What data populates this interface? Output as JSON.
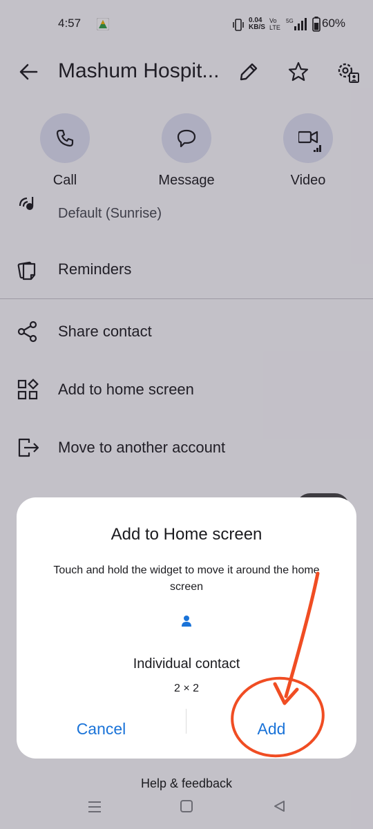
{
  "status_bar": {
    "time": "4:57",
    "right_text": "0.04 KB/S  60%",
    "battery": "60%"
  },
  "app_bar": {
    "title": "Mashum Hospit..."
  },
  "actions": [
    {
      "label": "Call"
    },
    {
      "label": "Message"
    },
    {
      "label": "Video"
    }
  ],
  "ringtone": {
    "value": "Default (Sunrise)"
  },
  "menu": {
    "reminders": "Reminders",
    "share": "Share contact",
    "add_home": "Add to home screen",
    "move": "Move to another account"
  },
  "dialog": {
    "title": "Add to Home screen",
    "description": "Touch and hold the widget to move it around the home screen",
    "widget_name": "Individual contact",
    "widget_size": "2 × 2",
    "cancel": "Cancel",
    "add": "Add"
  },
  "footer": {
    "help": "Help & feedback"
  },
  "colors": {
    "accent": "#1a73d8",
    "annotation": "#f04d23",
    "action_bg": "#dfe2f4"
  }
}
